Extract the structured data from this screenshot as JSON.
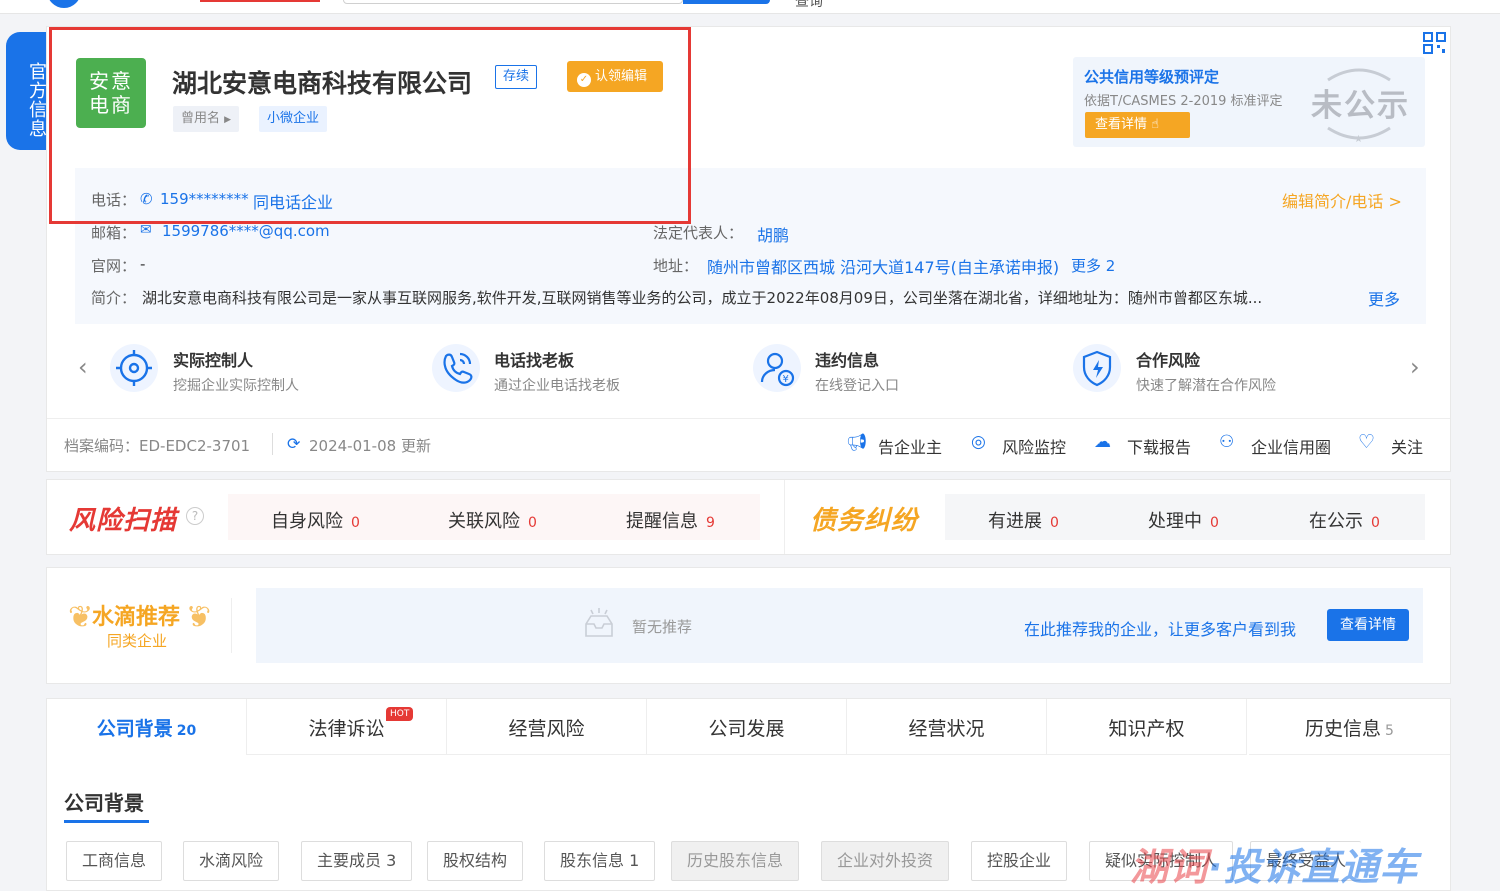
{
  "topbar": {
    "search_btn": "",
    "query_label": "查询"
  },
  "side_tab": {
    "label": "官方信息"
  },
  "company": {
    "logo_line1": "安意",
    "logo_line2": "电商",
    "name": "湖北安意电商科技有限公司",
    "status": "存续",
    "claim_label": "认领编辑",
    "former_name_label": "曾用名",
    "size_tag": "小微企业"
  },
  "credit": {
    "title": "公共信用等级预评定",
    "subtitle": "依据T/CASMES 2-2019 标准评定",
    "detail_btn": "查看详情",
    "result": "未公示"
  },
  "info": {
    "phone_label": "电话：",
    "phone_value": "159********",
    "same_phone": "同电话企业",
    "edit_intro": "编辑简介/电话 >",
    "email_label": "邮箱：",
    "email_value": "1599786****@qq.com",
    "legal_label": "法定代表人：",
    "legal_value": "胡鹏",
    "website_label": "官网：",
    "website_value": "-",
    "address_label": "地址：",
    "address_value": "随州市曾都区西城 沿河大道147号(自主承诺申报)",
    "address_more": "更多 2",
    "intro_label": "简介：",
    "intro_value": "湖北安意电商科技有限公司是一家从事互联网服务,软件开发,互联网销售等业务的公司，成立于2022年08月09日，公司坐落在湖北省，详细地址为：随州市曾都区东城...",
    "intro_more": "更多"
  },
  "services": [
    {
      "title": "实际控制人",
      "sub": "挖掘企业实际控制人"
    },
    {
      "title": "电话找老板",
      "sub": "通过企业电话找老板"
    },
    {
      "title": "违约信息",
      "sub": "在线登记入口"
    },
    {
      "title": "合作风险",
      "sub": "快速了解潜在合作风险"
    }
  ],
  "footer": {
    "code": "档案编码：ED-EDC2-3701",
    "updated": "2024-01-08 更新",
    "actions": [
      "告企业主",
      "风险监控",
      "下载报告",
      "企业信用圈",
      "关注"
    ]
  },
  "risk": {
    "logo": "风险扫描",
    "items": [
      {
        "label": "自身风险",
        "count": "0"
      },
      {
        "label": "关联风险",
        "count": "0"
      },
      {
        "label": "提醒信息",
        "count": "9"
      }
    ],
    "debt_logo": "债务纠纷",
    "debt_items": [
      {
        "label": "有进展",
        "count": "0"
      },
      {
        "label": "处理中",
        "count": "0"
      },
      {
        "label": "在公示",
        "count": "0"
      }
    ]
  },
  "recommend": {
    "title": "水滴推荐",
    "sub": "同类企业",
    "none": "暂无推荐",
    "link": "在此推荐我的企业，让更多客户看到我",
    "btn": "查看详情"
  },
  "tabs": [
    {
      "label": "公司背景",
      "count": "20"
    },
    {
      "label": "法律诉讼",
      "count": ""
    },
    {
      "label": "经营风险",
      "count": ""
    },
    {
      "label": "公司发展",
      "count": ""
    },
    {
      "label": "经营状况",
      "count": ""
    },
    {
      "label": "知识产权",
      "count": ""
    },
    {
      "label": "历史信息",
      "count": "5"
    }
  ],
  "hot_badge": "HOT",
  "section": {
    "title": "公司背景"
  },
  "subtabs": [
    "工商信息",
    "水滴风险",
    "主要成员 3",
    "股权结构",
    "股东信息 1",
    "历史股东信息",
    "企业对外投资",
    "控股企业",
    "疑似实际控制人",
    "最终受益人"
  ],
  "watermark": {
    "part1": "湖词",
    "part2": "·投诉直通车"
  },
  "colors": {
    "primary": "#1a73e8",
    "orange": "#f5a623",
    "red": "#e53935"
  }
}
